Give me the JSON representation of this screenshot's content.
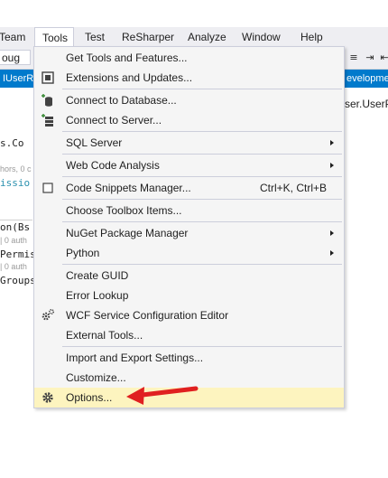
{
  "menubar": {
    "items": [
      {
        "label": "Team"
      },
      {
        "label": "Tools"
      },
      {
        "label": "Test"
      },
      {
        "label": "ReSharper"
      },
      {
        "label": "Analyze"
      },
      {
        "label": "Window"
      },
      {
        "label": "Help"
      }
    ]
  },
  "toolbar": {
    "config_combo": "oug"
  },
  "tabs": {
    "left": "IUserR",
    "right": "evelopmen"
  },
  "file_tab": "ser.UserP",
  "code_fragments": {
    "line1": "s.Co",
    "lens1": "hors, 0 c",
    "line2": "issio",
    "line3": "on(Bs",
    "lens2": "| 0 auth",
    "line4": "Permis",
    "lens3": "| 0 auth",
    "line5": "Groups"
  },
  "tools_menu": {
    "items": [
      {
        "label": "Get Tools and Features..."
      },
      {
        "label": "Extensions and Updates..."
      },
      {
        "label": "Connect to Database..."
      },
      {
        "label": "Connect to Server..."
      },
      {
        "label": "SQL Server"
      },
      {
        "label": "Web Code Analysis"
      },
      {
        "label": "Code Snippets Manager...",
        "shortcut": "Ctrl+K, Ctrl+B"
      },
      {
        "label": "Choose Toolbox Items..."
      },
      {
        "label": "NuGet Package Manager"
      },
      {
        "label": "Python"
      },
      {
        "label": "Create GUID"
      },
      {
        "label": "Error Lookup"
      },
      {
        "label": "WCF Service Configuration Editor"
      },
      {
        "label": "External Tools..."
      },
      {
        "label": "Import and Export Settings..."
      },
      {
        "label": "Customize..."
      },
      {
        "label": "Options..."
      }
    ]
  },
  "colors": {
    "highlight": "#fdf4bf",
    "annotation_arrow": "#e02020",
    "accent": "#007acc"
  }
}
